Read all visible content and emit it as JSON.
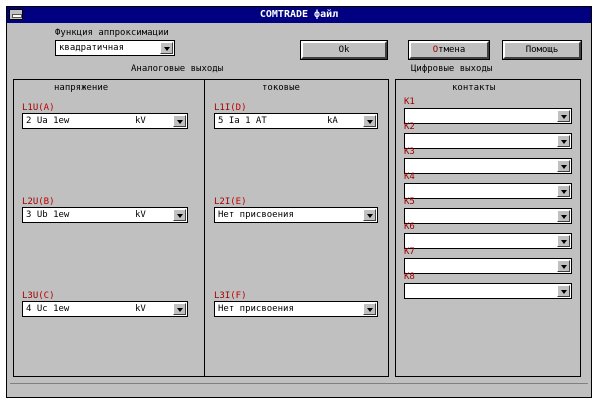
{
  "window": {
    "title": "COMTRADE файл"
  },
  "approx": {
    "label": "Функция аппроксимации",
    "value": "квадратичная"
  },
  "buttons": {
    "ok": "Ok",
    "cancel_hot": "О",
    "cancel_rest": "тмена",
    "help": "Помощь"
  },
  "sections": {
    "analog": "Аналоговые выходы",
    "digital": "Цифровые выходы",
    "voltage": "напряжение",
    "current": "токовые",
    "contacts": "контакты"
  },
  "voltage_channels": [
    {
      "name": "L1U",
      "key": "(A)",
      "value": "2 Ua 1ew",
      "unit": "kV"
    },
    {
      "name": "L2U",
      "key": "(B)",
      "value": "3 Ub 1ew",
      "unit": "kV"
    },
    {
      "name": "L3U",
      "key": "(C)",
      "value": "4 Uc 1ew",
      "unit": "kV"
    }
  ],
  "current_channels": [
    {
      "name": "L1I",
      "key": "(D)",
      "value": "5 Ia 1 AT",
      "unit": "kA"
    },
    {
      "name": "L2I",
      "key": "(E)",
      "value": "Нет присвоения",
      "unit": ""
    },
    {
      "name": "L3I",
      "key": "(F)",
      "value": "Нет присвоения",
      "unit": ""
    }
  ],
  "digital_channels": [
    {
      "name": "K1",
      "value": ""
    },
    {
      "name": "K2",
      "value": ""
    },
    {
      "name": "K3",
      "value": ""
    },
    {
      "name": "K4",
      "value": ""
    },
    {
      "name": "K5",
      "value": ""
    },
    {
      "name": "K6",
      "value": ""
    },
    {
      "name": "K7",
      "value": ""
    },
    {
      "name": "K8",
      "value": ""
    }
  ]
}
